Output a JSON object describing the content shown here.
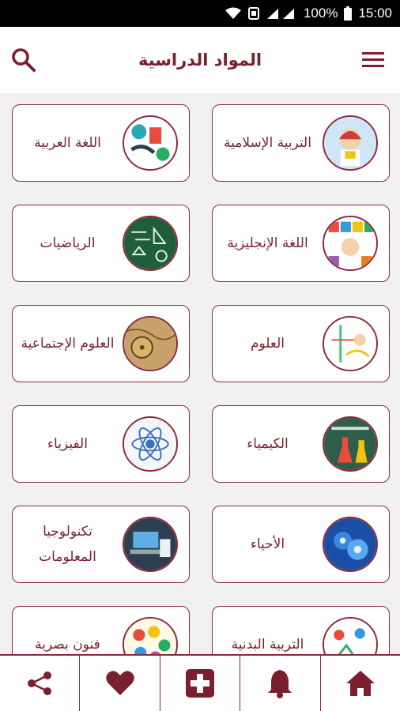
{
  "status_bar": {
    "battery": "100%",
    "time": "15:00",
    "icons": [
      "wifi-icon",
      "nfc-icon",
      "signal-icon",
      "battery-icon"
    ]
  },
  "app_bar": {
    "title": "المواد الدراسية",
    "icons": [
      "search-icon",
      "menu-icon"
    ]
  },
  "subjects": [
    {
      "label": "التربية الإسلامية",
      "icon": "islamic-education-thumbnail"
    },
    {
      "label": "اللغة العربية",
      "icon": "arabic-language-thumbnail"
    },
    {
      "label": "اللغة الإنجليزية",
      "icon": "english-language-thumbnail"
    },
    {
      "label": "الرياضيات",
      "icon": "mathematics-thumbnail"
    },
    {
      "label": "العلوم",
      "icon": "science-thumbnail"
    },
    {
      "label": "العلوم الإجتماعية",
      "icon": "social-studies-thumbnail"
    },
    {
      "label": "الكيمياء",
      "icon": "chemistry-thumbnail"
    },
    {
      "label": "الفيزياء",
      "icon": "physics-thumbnail"
    },
    {
      "label": "الأحياء",
      "icon": "biology-thumbnail"
    },
    {
      "label": "تكنولوجيا المعلومات",
      "icon": "information-technology-thumbnail"
    },
    {
      "label": "التربية البدنية",
      "icon": "physical-education-thumbnail"
    },
    {
      "label": "فنون بصرية",
      "icon": "visual-arts-thumbnail"
    }
  ],
  "bottom_nav": {
    "items": [
      "home-icon",
      "bell-icon",
      "plus-icon",
      "heart-icon",
      "share-icon"
    ]
  },
  "colors": {
    "accent": "#8b2a3a",
    "title": "#7a1f2e",
    "background": "#f1f1f1"
  }
}
